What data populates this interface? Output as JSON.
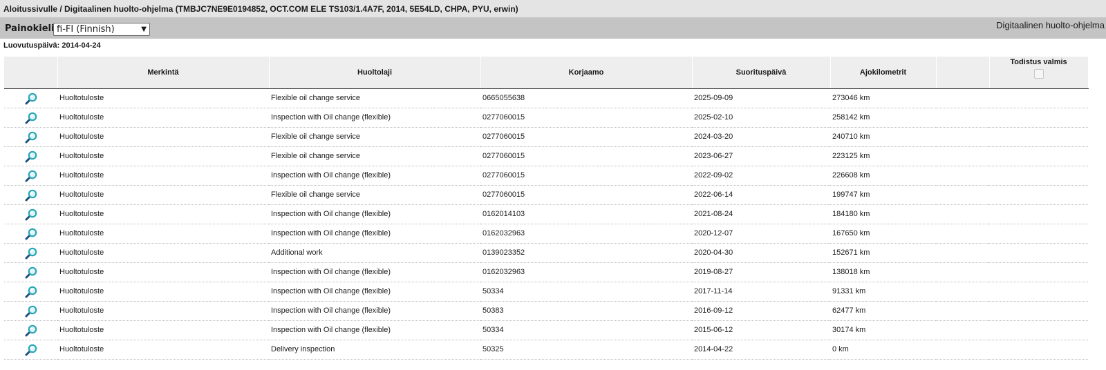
{
  "breadcrumb": "Aloitussivulle / Digitaalinen huolto-ohjelma (TMBJC7NE9E0194852, OCT.COM ELE TS103/1.4A7F, 2014, 5E54LD, CHPA, PYU, erwin)",
  "language": {
    "label": "Painokieli:",
    "selected": "fi-FI (Finnish)"
  },
  "app_title": "Digitaalinen huolto-ohjelma",
  "delivery_date": "Luovutuspäivä: 2014-04-24",
  "table": {
    "columns": {
      "icon": "",
      "merkinta": "Merkintä",
      "huoltolaji": "Huoltolaji",
      "korjaamo": "Korjaamo",
      "suorituspaiva": "Suorituspäivä",
      "ajokilometrit": "Ajokilometrit",
      "extra": "",
      "todistus": "Todistus valmis"
    },
    "rows": [
      {
        "merkinta": "Huoltotuloste",
        "huoltolaji": "Flexible oil change service",
        "korjaamo": "0665055638",
        "paiva": "2025-09-09",
        "km": "273046 km"
      },
      {
        "merkinta": "Huoltotuloste",
        "huoltolaji": "Inspection with Oil change (flexible)",
        "korjaamo": "0277060015",
        "paiva": "2025-02-10",
        "km": "258142 km"
      },
      {
        "merkinta": "Huoltotuloste",
        "huoltolaji": "Flexible oil change service",
        "korjaamo": "0277060015",
        "paiva": "2024-03-20",
        "km": "240710 km"
      },
      {
        "merkinta": "Huoltotuloste",
        "huoltolaji": "Flexible oil change service",
        "korjaamo": "0277060015",
        "paiva": "2023-06-27",
        "km": "223125 km"
      },
      {
        "merkinta": "Huoltotuloste",
        "huoltolaji": "Inspection with Oil change (flexible)",
        "korjaamo": "0277060015",
        "paiva": "2022-09-02",
        "km": "226608 km"
      },
      {
        "merkinta": "Huoltotuloste",
        "huoltolaji": "Flexible oil change service",
        "korjaamo": "0277060015",
        "paiva": "2022-06-14",
        "km": "199747 km"
      },
      {
        "merkinta": "Huoltotuloste",
        "huoltolaji": "Inspection with Oil change (flexible)",
        "korjaamo": "0162014103",
        "paiva": "2021-08-24",
        "km": "184180 km"
      },
      {
        "merkinta": "Huoltotuloste",
        "huoltolaji": "Inspection with Oil change (flexible)",
        "korjaamo": "0162032963",
        "paiva": "2020-12-07",
        "km": "167650 km"
      },
      {
        "merkinta": "Huoltotuloste",
        "huoltolaji": "Additional work",
        "korjaamo": "0139023352",
        "paiva": "2020-04-30",
        "km": "152671 km"
      },
      {
        "merkinta": "Huoltotuloste",
        "huoltolaji": "Inspection with Oil change (flexible)",
        "korjaamo": "0162032963",
        "paiva": "2019-08-27",
        "km": "138018 km"
      },
      {
        "merkinta": "Huoltotuloste",
        "huoltolaji": "Inspection with Oil change (flexible)",
        "korjaamo": "50334",
        "paiva": "2017-11-14",
        "km": "91331 km"
      },
      {
        "merkinta": "Huoltotuloste",
        "huoltolaji": "Inspection with Oil change (flexible)",
        "korjaamo": "50383",
        "paiva": "2016-09-12",
        "km": "62477 km"
      },
      {
        "merkinta": "Huoltotuloste",
        "huoltolaji": "Inspection with Oil change (flexible)",
        "korjaamo": "50334",
        "paiva": "2015-06-12",
        "km": "30174 km"
      },
      {
        "merkinta": "Huoltotuloste",
        "huoltolaji": "Delivery inspection",
        "korjaamo": "50325",
        "paiva": "2014-04-22",
        "km": "0 km"
      }
    ]
  },
  "icons": {
    "view": "magnifier-icon"
  },
  "colors": {
    "magnifier_lens": "#2aa6b8",
    "magnifier_handle": "#1d4f7a"
  }
}
